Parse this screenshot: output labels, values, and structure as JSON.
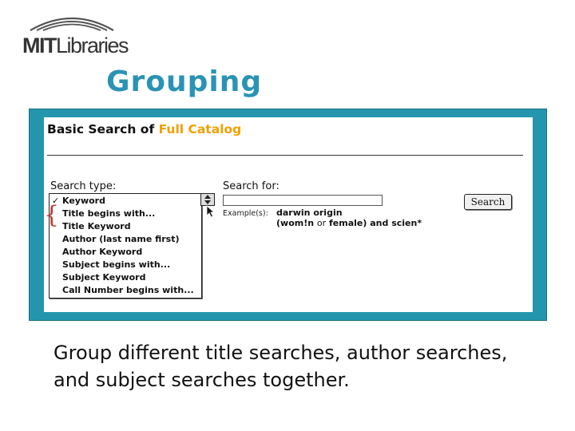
{
  "logo": {
    "mit": "MIT",
    "libraries": "Libraries"
  },
  "slide": {
    "title": "Grouping",
    "caption": "Group different title searches, author searches, and subject searches together."
  },
  "catalog": {
    "heading_prefix": "Basic Search of",
    "heading_scope": "Full Catalog",
    "search_type_label": "Search type:",
    "search_for_label": "Search for:",
    "search_for_value": "",
    "search_types": [
      {
        "label": "Keyword",
        "checked": true
      },
      {
        "label": "Title begins with...",
        "checked": false
      },
      {
        "label": "Title Keyword",
        "checked": false
      },
      {
        "label": "Author (last name first)",
        "checked": false
      },
      {
        "label": "Author Keyword",
        "checked": false
      },
      {
        "label": "Subject begins with...",
        "checked": false
      },
      {
        "label": "Subject Keyword",
        "checked": false
      },
      {
        "label": "Call Number begins with...",
        "checked": false
      }
    ],
    "check_mark": "✓",
    "examples_label": "Example(s):",
    "example1": "darwin origin",
    "example2_part1": "(wom!n",
    "example2_or": "or",
    "example2_part2": "female) and scien*",
    "search_button": "Search"
  },
  "annotation": {
    "brace": "{"
  },
  "colors": {
    "frame": "#2396ad",
    "title": "#2a93b5",
    "scope": "#f0a000",
    "brace": "#c03a3a"
  },
  "icons": {
    "scroll": "up-down-arrows-icon",
    "cursor": "mouse-pointer-icon",
    "logo_arc": "arc-icon"
  }
}
